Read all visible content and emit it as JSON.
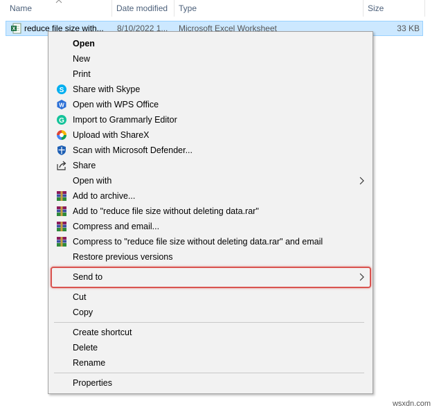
{
  "header": {
    "name": "Name",
    "date_modified": "Date modified",
    "type": "Type",
    "size": "Size"
  },
  "file": {
    "name": "reduce file size with...",
    "date": "8/10/2022 1...",
    "type": "Microsoft Excel Worksheet",
    "size": "33 KB",
    "icon": "excel-file-icon"
  },
  "menu": {
    "open": "Open",
    "new": "New",
    "print": "Print",
    "share_skype": "Share with Skype",
    "open_wps": "Open with WPS Office",
    "grammarly": "Import to Grammarly Editor",
    "sharex": "Upload with ShareX",
    "defender": "Scan with Microsoft Defender...",
    "share": "Share",
    "open_with": "Open with",
    "add_archive": "Add to archive...",
    "add_rar": "Add to \"reduce file size without deleting data.rar\"",
    "compress_email": "Compress and email...",
    "compress_rar_email": "Compress to \"reduce file size without deleting data.rar\" and email",
    "restore": "Restore previous versions",
    "send_to": "Send to",
    "cut": "Cut",
    "copy": "Copy",
    "create_shortcut": "Create shortcut",
    "delete": "Delete",
    "rename": "Rename",
    "properties": "Properties"
  },
  "colors": {
    "selection_bg": "#cce8ff",
    "highlight_border": "#d9534f",
    "menu_bg": "#f2f2f2"
  },
  "watermark": "wsxdn.com"
}
